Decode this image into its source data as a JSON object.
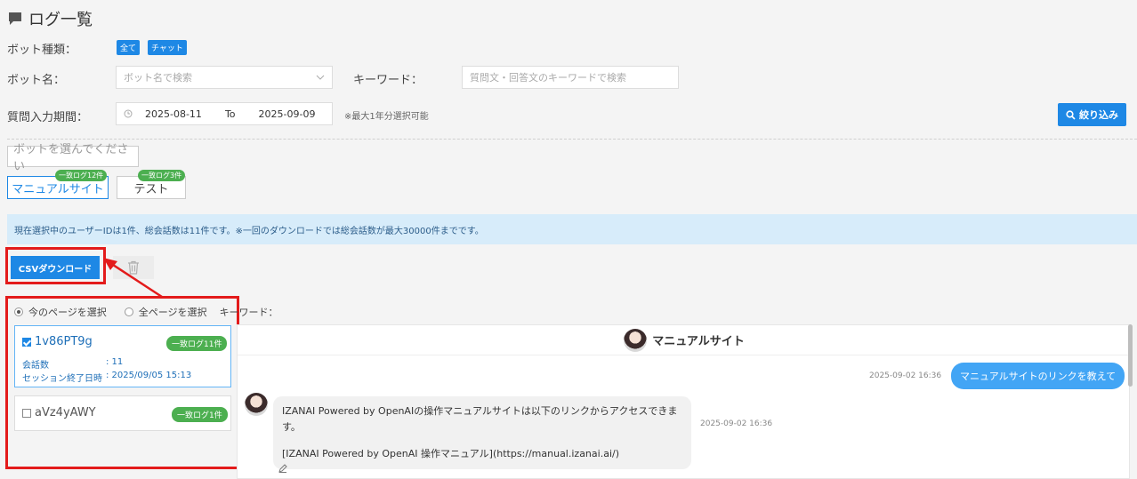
{
  "page": {
    "title": "ログ一覧"
  },
  "filters": {
    "bot_type_label": "ボット種類：",
    "bot_type_tags": [
      "全て",
      "チャット"
    ],
    "bot_name_label": "ボット名：",
    "bot_name_placeholder": "ボット名で検索",
    "keyword_label": "キーワード：",
    "keyword_placeholder": "質問文・回答文のキーワードで検索",
    "period_label": "質問入力期間：",
    "date_from": "2025-08-11",
    "date_to_label": "To",
    "date_to": "2025-09-09",
    "period_note": "※最大1年分選択可能",
    "search_button": "絞り込み"
  },
  "bots": {
    "prompt": "ボットを選んでください",
    "items": [
      {
        "name": "マニュアルサイト",
        "badge": "一致ログ12件"
      },
      {
        "name": "テスト",
        "badge": "一致ログ3件"
      }
    ]
  },
  "info_bar": "現在選択中のユーザーIDは1件、総会話数は11件です。※一回のダウンロードでは総会話数が最大30000件までです。",
  "actions": {
    "csv_download": "CSVダウンロード"
  },
  "selection": {
    "current_page": "今のページを選択",
    "all_pages": "全ページを選択",
    "keyword_label": "キーワード："
  },
  "sessions": [
    {
      "id": "1v86PT9g",
      "badge": "一致ログ11件",
      "count_label": "会話数",
      "count_value": ": 11",
      "end_label": "セッション終了日時",
      "end_value": ": 2025/09/05 15:13"
    },
    {
      "id": "aVz4yAWY",
      "badge": "一致ログ1件"
    }
  ],
  "chat": {
    "header": "マニュアルサイト",
    "messages": [
      {
        "role": "user",
        "time": "2025-09-02 16:36",
        "text": "マニュアルサイトのリンクを教えて"
      },
      {
        "role": "bot",
        "time": "2025-09-02 16:36",
        "line1": "IZANAI Powered by OpenAIの操作マニュアルサイトは以下のリンクからアクセスできます。",
        "line2": "[IZANAI Powered by OpenAI 操作マニュアル](https://manual.izanai.ai/)"
      }
    ]
  },
  "colors": {
    "accent": "#1e88e5",
    "highlight_red": "#e31b1b",
    "badge_green": "#4caf50",
    "info_bg": "#d7ecfa"
  }
}
